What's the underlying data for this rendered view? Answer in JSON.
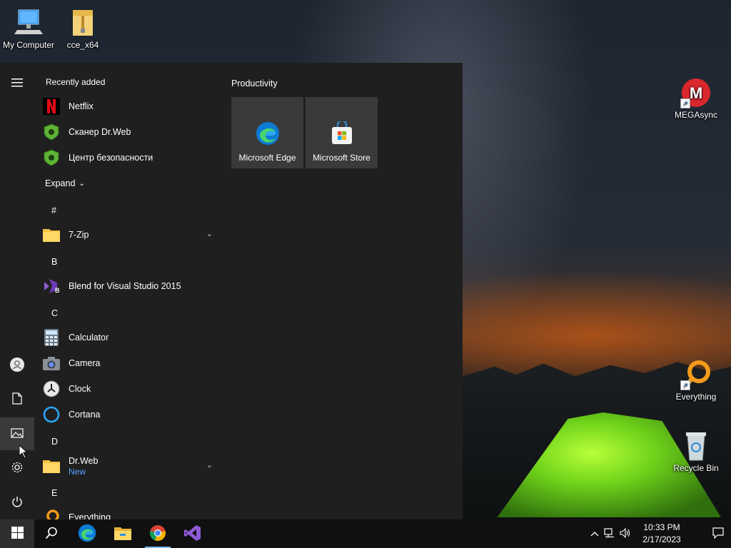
{
  "desktop": {
    "icons": [
      {
        "label": "My Computer"
      },
      {
        "label": "cce_x64"
      },
      {
        "label": "MEGAsync"
      },
      {
        "label": "Everything"
      },
      {
        "label": "Recycle Bin"
      }
    ]
  },
  "start_menu": {
    "recently_added_title": "Recently added",
    "recent_apps": [
      {
        "name": "Netflix"
      },
      {
        "name": "Сканер Dr.Web"
      },
      {
        "name": "Центр безопасности"
      }
    ],
    "expand_label": "Expand",
    "sections": [
      {
        "letter": "#"
      },
      {
        "letter": "B"
      },
      {
        "letter": "C"
      },
      {
        "letter": "D"
      },
      {
        "letter": "E"
      }
    ],
    "apps": [
      {
        "name": "7-Zip"
      },
      {
        "name": "Blend for Visual Studio 2015"
      },
      {
        "name": "Calculator"
      },
      {
        "name": "Camera"
      },
      {
        "name": "Clock"
      },
      {
        "name": "Cortana"
      },
      {
        "name": "Dr.Web",
        "badge": "New"
      },
      {
        "name": "Everything"
      }
    ],
    "tiles_group_title": "Productivity",
    "tiles": [
      {
        "label": "Microsoft Edge"
      },
      {
        "label": "Microsoft Store"
      }
    ]
  },
  "taskbar": {
    "clock_time": "10:33 PM",
    "clock_date": "2/17/2023"
  },
  "colors": {
    "accent": "#76b9ed",
    "start_bg": "#1f1f1f",
    "tile_bg": "#3a3a3a",
    "new_badge": "#5aa0ff"
  }
}
